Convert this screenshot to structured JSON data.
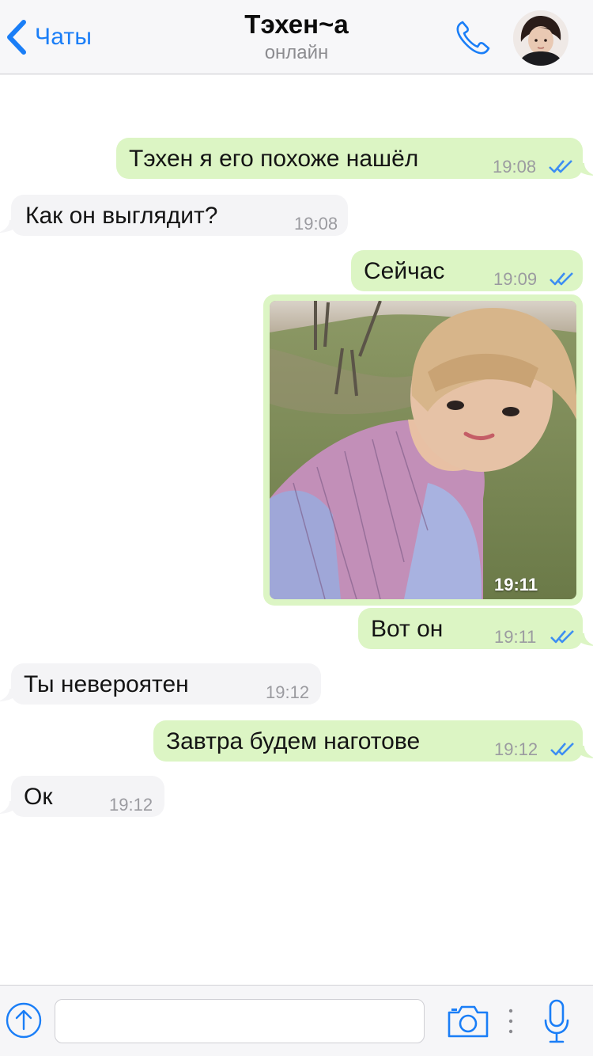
{
  "header": {
    "back_label": "Чаты",
    "title": "Тэхен~а",
    "status": "онлайн"
  },
  "messages": [
    {
      "direction": "out",
      "text": "Тэхен я его похоже нашёл",
      "time": "19:08",
      "read": true
    },
    {
      "direction": "in",
      "text": "Как он выглядит?",
      "time": "19:08"
    },
    {
      "direction": "out",
      "text": "Сейчас",
      "time": "19:09",
      "read": true
    },
    {
      "direction": "out",
      "type": "photo",
      "time": "19:11",
      "read": true
    },
    {
      "direction": "out",
      "text": "Вот он",
      "time": "19:11",
      "read": true
    },
    {
      "direction": "in",
      "text": "Ты невероятен",
      "time": "19:12"
    },
    {
      "direction": "out",
      "text": "Завтра будем наготове",
      "time": "19:12",
      "read": true
    },
    {
      "direction": "in",
      "text": "Ок",
      "time": "19:12"
    }
  ],
  "input": {
    "value": "",
    "placeholder": ""
  },
  "icons": {
    "back": "chevron-left-icon",
    "call": "phone-icon",
    "attach": "upload-arrow-icon",
    "camera": "camera-icon",
    "mic": "microphone-icon",
    "read_receipt": "double-check-icon"
  },
  "colors": {
    "accent": "#1a7ef7",
    "outgoing_bubble": "#dcf5c4",
    "incoming_bubble": "#f4f4f6",
    "read_ticks": "#3d8ef2"
  }
}
